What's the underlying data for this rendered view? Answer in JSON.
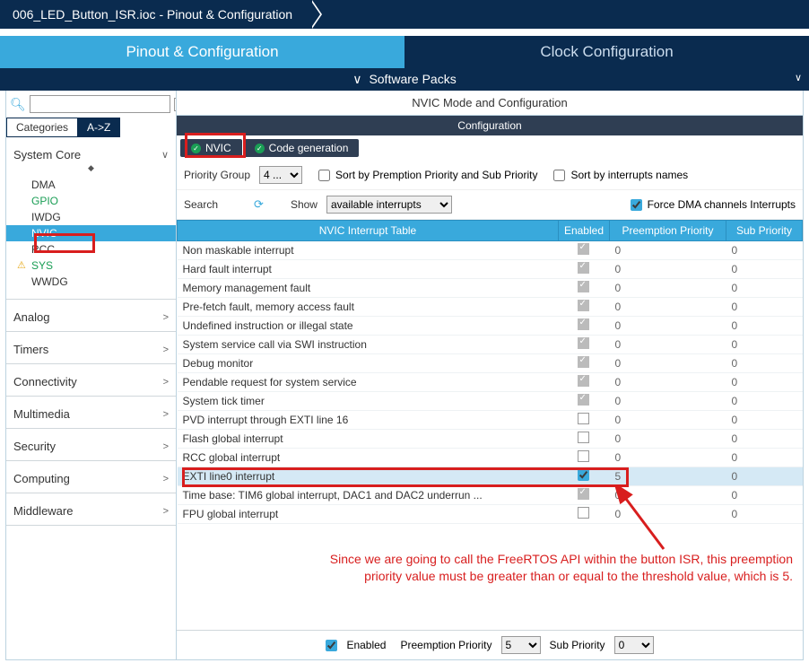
{
  "breadcrumb": {
    "title": "006_LED_Button_ISR.ioc - Pinout & Configuration"
  },
  "main_tabs": {
    "pinout": "Pinout & Configuration",
    "clock": "Clock Configuration"
  },
  "sub_bar": {
    "label": "Software Packs"
  },
  "sidebar": {
    "mode_tabs": {
      "cat": "Categories",
      "az": "A->Z"
    },
    "system_core": {
      "label": "System Core",
      "items": [
        {
          "label": "DMA"
        },
        {
          "label": "GPIO",
          "green": true
        },
        {
          "label": "IWDG"
        },
        {
          "label": "NVIC",
          "selected": true
        },
        {
          "label": "RCC"
        },
        {
          "label": "SYS",
          "green": true,
          "warn": true
        },
        {
          "label": "WWDG"
        }
      ]
    },
    "groups": [
      {
        "label": "Analog"
      },
      {
        "label": "Timers"
      },
      {
        "label": "Connectivity"
      },
      {
        "label": "Multimedia"
      },
      {
        "label": "Security"
      },
      {
        "label": "Computing"
      },
      {
        "label": "Middleware"
      }
    ]
  },
  "main": {
    "title": "NVIC Mode and Configuration",
    "conf_header": "Configuration",
    "tabs": {
      "nvic": "NVIC",
      "codegen": "Code generation"
    },
    "controls": {
      "priority_group_label": "Priority Group",
      "priority_group_value": "4 ...",
      "sort_preempt": "Sort by Premption Priority and Sub Priority",
      "sort_names": "Sort by interrupts names",
      "search_label": "Search",
      "show_label": "Show",
      "show_value": "available interrupts",
      "force_dma": "Force DMA channels Interrupts"
    },
    "table": {
      "headers": {
        "name": "NVIC Interrupt Table",
        "enabled": "Enabled",
        "preempt": "Preemption Priority",
        "sub": "Sub Priority"
      },
      "rows": [
        {
          "name": "Non maskable interrupt",
          "enabled": true,
          "locked": true,
          "preempt": "0",
          "sub": "0"
        },
        {
          "name": "Hard fault interrupt",
          "enabled": true,
          "locked": true,
          "preempt": "0",
          "sub": "0"
        },
        {
          "name": "Memory management fault",
          "enabled": true,
          "locked": true,
          "preempt": "0",
          "sub": "0"
        },
        {
          "name": "Pre-fetch fault, memory access fault",
          "enabled": true,
          "locked": true,
          "preempt": "0",
          "sub": "0"
        },
        {
          "name": "Undefined instruction or illegal state",
          "enabled": true,
          "locked": true,
          "preempt": "0",
          "sub": "0"
        },
        {
          "name": "System service call via SWI instruction",
          "enabled": true,
          "locked": true,
          "preempt": "0",
          "sub": "0"
        },
        {
          "name": "Debug monitor",
          "enabled": true,
          "locked": true,
          "preempt": "0",
          "sub": "0"
        },
        {
          "name": "Pendable request for system service",
          "enabled": true,
          "locked": true,
          "preempt": "0",
          "sub": "0"
        },
        {
          "name": "System tick timer",
          "enabled": true,
          "locked": true,
          "preempt": "0",
          "sub": "0"
        },
        {
          "name": "PVD interrupt through EXTI line 16",
          "enabled": false,
          "locked": false,
          "preempt": "0",
          "sub": "0"
        },
        {
          "name": "Flash global interrupt",
          "enabled": false,
          "locked": false,
          "preempt": "0",
          "sub": "0"
        },
        {
          "name": "RCC global interrupt",
          "enabled": false,
          "locked": false,
          "preempt": "0",
          "sub": "0"
        },
        {
          "name": "EXTI line0 interrupt",
          "enabled": true,
          "locked": false,
          "blue": true,
          "preempt": "5",
          "sub": "0",
          "hl": true
        },
        {
          "name": "Time base: TIM6 global interrupt, DAC1 and DAC2 underrun ...",
          "enabled": true,
          "locked": true,
          "preempt": "0",
          "sub": "0"
        },
        {
          "name": "FPU global interrupt",
          "enabled": false,
          "locked": false,
          "preempt": "0",
          "sub": "0"
        }
      ]
    },
    "footer": {
      "enabled_label": "Enabled",
      "preempt_label": "Preemption Priority",
      "preempt_value": "5",
      "sub_label": "Sub Priority",
      "sub_value": "0"
    }
  },
  "annotation": "Since we are going to call the FreeRTOS API within the button ISR, this preemption priority value must be greater than or equal to the threshold value, which is 5."
}
